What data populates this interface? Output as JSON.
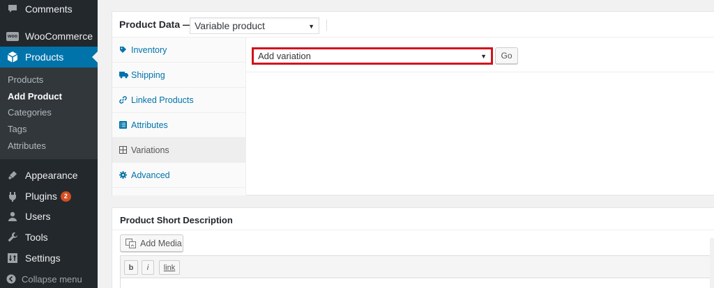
{
  "sidebar": {
    "comments": "Comments",
    "woocommerce": "WooCommerce",
    "woo_icon_text": "woo",
    "products": "Products",
    "submenu": [
      "Products",
      "Add Product",
      "Categories",
      "Tags",
      "Attributes"
    ],
    "appearance": "Appearance",
    "plugins": "Plugins",
    "plugins_badge": "2",
    "users": "Users",
    "tools": "Tools",
    "settings": "Settings",
    "collapse": "Collapse menu"
  },
  "product_data": {
    "title": "Product Data —",
    "type_selected": "Variable product",
    "tabs": [
      "Inventory",
      "Shipping",
      "Linked Products",
      "Attributes",
      "Variations",
      "Advanced"
    ],
    "active_tab": "Variations",
    "variation_select": "Add variation",
    "go_button": "Go"
  },
  "short_description": {
    "title": "Product Short Description",
    "add_media": "Add Media",
    "toolbar": {
      "bold": "b",
      "italic": "i",
      "link": "link"
    }
  },
  "colors": {
    "sidebar_bg": "#23282d",
    "active_menu": "#0073aa",
    "link": "#0073aa",
    "highlight_border": "#d0121c",
    "badge": "#d54e21"
  }
}
